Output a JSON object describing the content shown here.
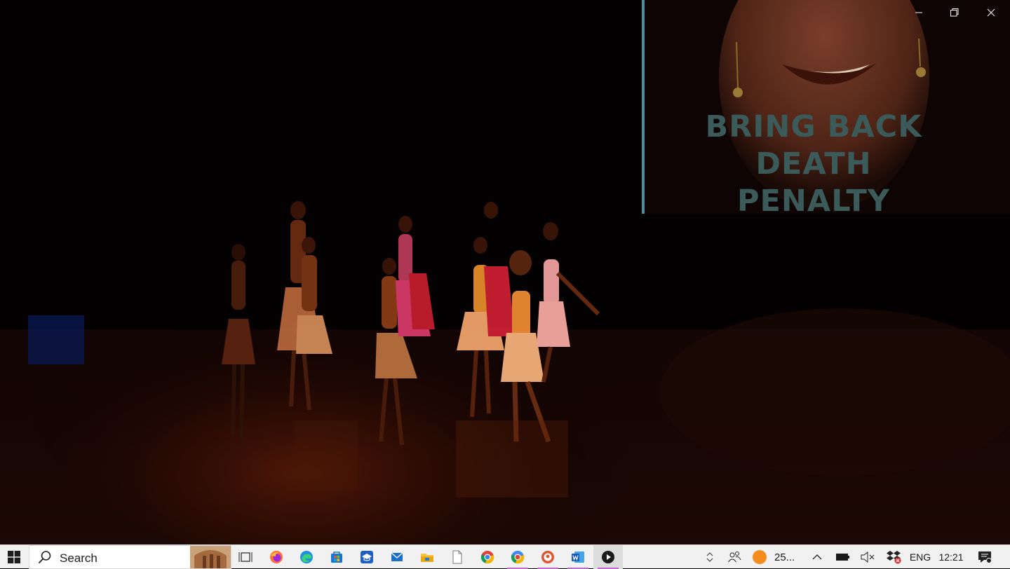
{
  "video": {
    "slide_caption_lines": [
      "BRING BACK",
      "DEATH",
      "PENALTY"
    ]
  },
  "window_controls": {
    "minimize_icon": "minimize-icon",
    "restore_icon": "restore-icon",
    "close_icon": "close-icon"
  },
  "taskbar": {
    "search_placeholder": "Search",
    "pinned_apps": [
      "task-view",
      "firefox",
      "edge",
      "store",
      "tile-app",
      "mail",
      "file-explorer",
      "notepad",
      "chrome",
      "chrome-dev",
      "duckduckgo",
      "word",
      "media-player"
    ],
    "tray": {
      "weather_text": "25...",
      "language": "ENG",
      "time": "12:21"
    },
    "colors": {
      "taskbar_bg": "#f1f1f1",
      "accent_running": "#c26bd0",
      "windows_logo": "#1e1e1e"
    }
  }
}
